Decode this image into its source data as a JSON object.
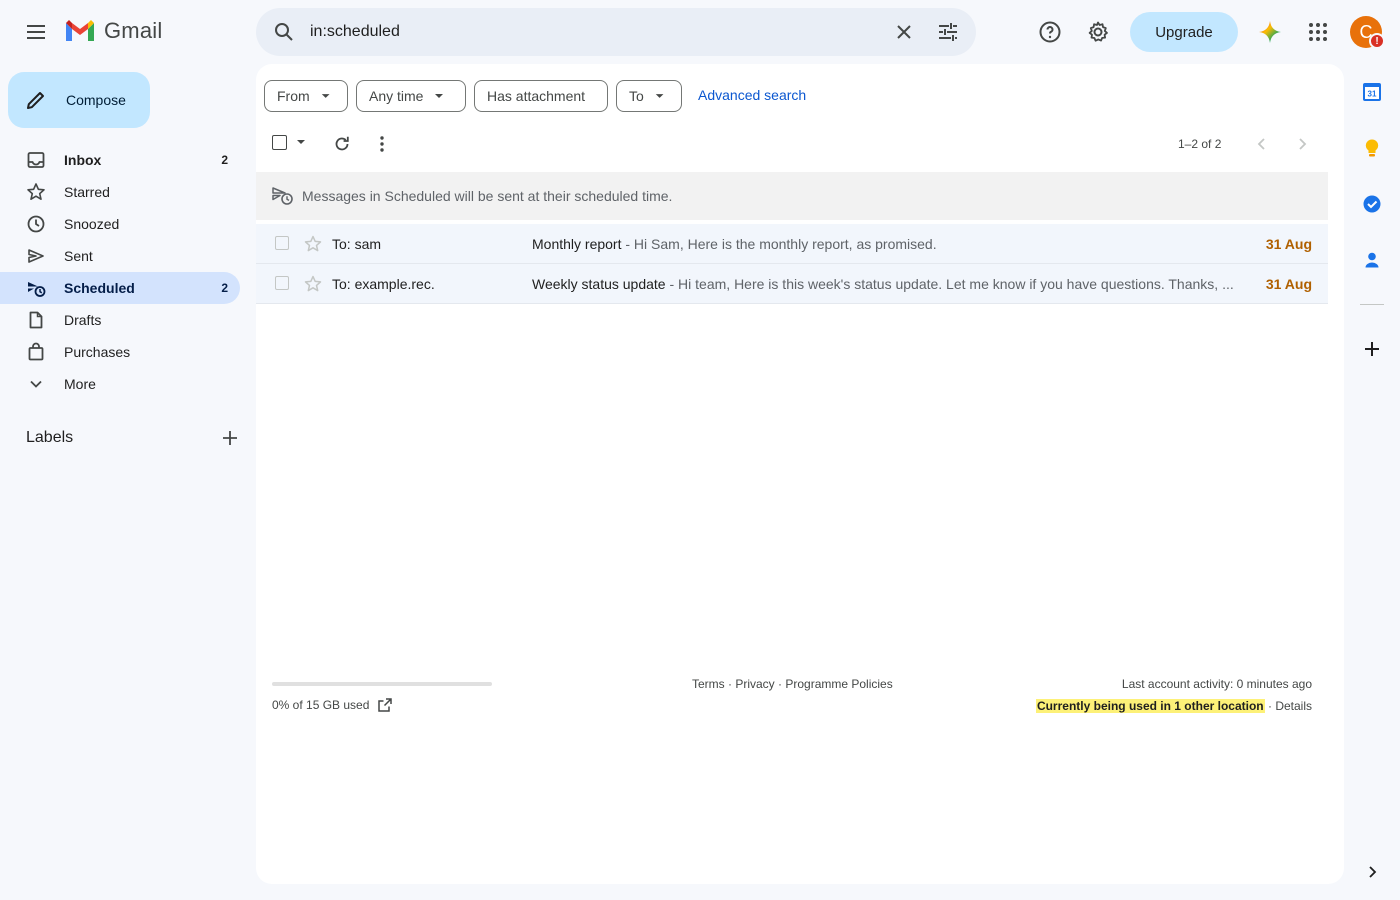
{
  "app": {
    "name": "Gmail"
  },
  "search": {
    "value": "in:scheduled"
  },
  "header": {
    "upgrade_label": "Upgrade",
    "avatar_initial": "C",
    "avatar_alert": "!"
  },
  "compose": {
    "label": "Compose"
  },
  "sidebar": {
    "items": [
      {
        "label": "Inbox",
        "count": "2",
        "icon": "inbox-icon"
      },
      {
        "label": "Starred",
        "count": "",
        "icon": "star-icon"
      },
      {
        "label": "Snoozed",
        "count": "",
        "icon": "clock-icon"
      },
      {
        "label": "Sent",
        "count": "",
        "icon": "send-icon"
      },
      {
        "label": "Scheduled",
        "count": "2",
        "icon": "scheduled-send-icon"
      },
      {
        "label": "Drafts",
        "count": "",
        "icon": "draft-icon"
      },
      {
        "label": "Purchases",
        "count": "",
        "icon": "shopping-bag-icon"
      },
      {
        "label": "More",
        "count": "",
        "icon": "chevron-down-icon"
      }
    ],
    "labels_title": "Labels"
  },
  "filters": {
    "from": "From",
    "any_time": "Any time",
    "has_attachment": "Has attachment",
    "to": "To",
    "advanced": "Advanced search"
  },
  "pager": {
    "text": "1–2 of 2"
  },
  "banner": {
    "text": "Messages in Scheduled will be sent at their scheduled time."
  },
  "messages": [
    {
      "to": "To: sam",
      "subject": "Monthly report",
      "snippet": " - Hi Sam, Here is the monthly report, as promised.",
      "date": "31 Aug"
    },
    {
      "to": "To: example.rec.",
      "subject": "Weekly status update",
      "snippet": " - Hi team, Here is this week's status update. Let me know if you have questions. Thanks, ...",
      "date": "31 Aug"
    }
  ],
  "footer": {
    "storage_text": "0% of 15 GB used",
    "storage_fraction": 0,
    "terms": "Terms",
    "privacy": "Privacy",
    "policies": "Programme Policies",
    "sep": " · ",
    "last_activity": "Last account activity: 0 minutes ago",
    "other_location": "Currently being used in 1 other location",
    "details": "Details"
  },
  "side_panel": {
    "calendar_day": "31",
    "apps": [
      "calendar-icon",
      "keep-icon",
      "tasks-icon",
      "contacts-icon"
    ]
  },
  "colors": {
    "accent": "#0b57d0",
    "compose_bg": "#c2e7ff",
    "active_nav": "#d3e3fd",
    "date_orange": "#b06000",
    "avatar": "#e8710a"
  }
}
